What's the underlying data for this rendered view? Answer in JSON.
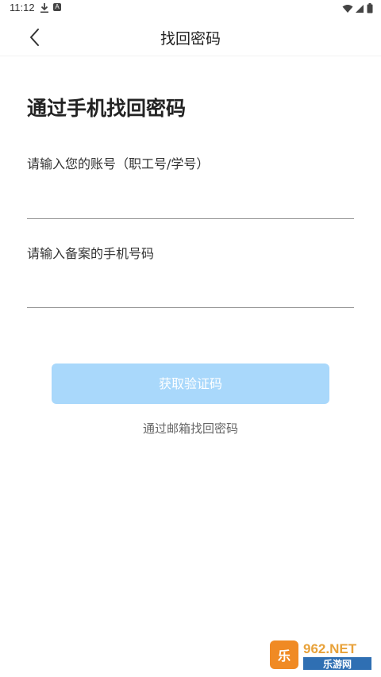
{
  "status_bar": {
    "time": "11:12",
    "icons": [
      "download-icon",
      "a-icon",
      "wifi-icon",
      "signal-icon",
      "battery-icon"
    ]
  },
  "header": {
    "title": "找回密码",
    "back_icon": "chevron-left-icon"
  },
  "main": {
    "heading": "通过手机找回密码",
    "account_field": {
      "label": "请输入您的账号（职工号/学号）",
      "value": ""
    },
    "phone_field": {
      "label": "请输入备案的手机号码",
      "value": ""
    },
    "get_code_button": "获取验证码",
    "email_link": "通过邮箱找回密码"
  },
  "watermark": {
    "brand_top": "962.NET",
    "brand_bottom": "乐游网"
  },
  "colors": {
    "primary_disabled": "#a9d8fb",
    "text_primary": "#222222",
    "text_secondary": "#666666",
    "divider": "#9a9a9a"
  }
}
